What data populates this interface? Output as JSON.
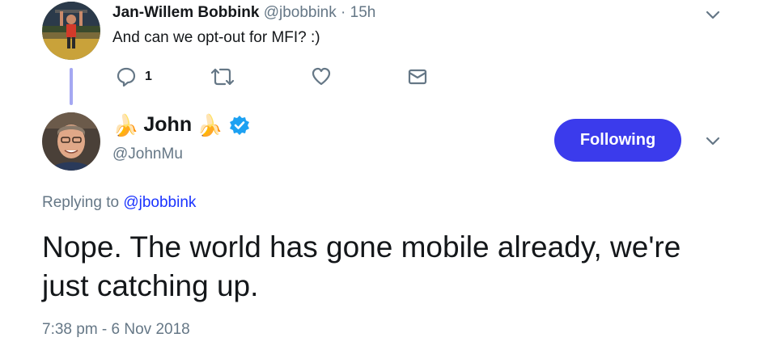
{
  "reply_tweet": {
    "author_name": "Jan-Willem Bobbink",
    "author_handle": "@jbobbink",
    "separator": "·",
    "time_ago": "15h",
    "text": "And can we opt-out for MFI? :)",
    "actions": {
      "reply_count": "1"
    }
  },
  "main_tweet": {
    "name_prefix_emoji": "🍌",
    "display_name": "John",
    "name_suffix_emoji": "🍌",
    "handle": "@JohnMu",
    "follow_label": "Following",
    "replying_to_label": "Replying to",
    "replying_to_handle": "@jbobbink",
    "text": "Nope. The world has gone mobile already, we're just catching up.",
    "timestamp": "7:38 pm - 6 Nov 2018"
  },
  "icons": {
    "verified": "verified-badge-icon",
    "more": "chevron-down-icon",
    "reply": "reply-bubble-icon",
    "retweet": "retweet-icon",
    "like": "heart-icon",
    "dm": "envelope-icon"
  },
  "colors": {
    "accent": "#3b3bec",
    "link": "#1a33ff",
    "muted": "#657786",
    "thread_line": "#a5a8f2",
    "verified": "#1da1f2"
  }
}
